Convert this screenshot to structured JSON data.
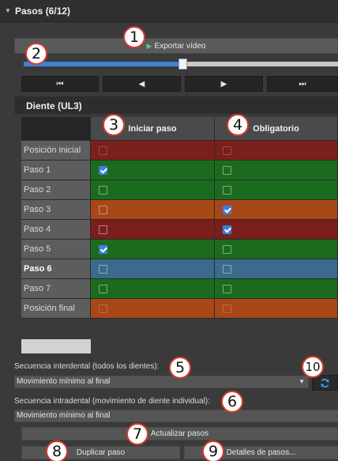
{
  "section": {
    "title": "Pasos (6/12)",
    "icon": "collapse-triangle-icon"
  },
  "export_button": {
    "label": "Exportar vídeo",
    "icon": "play-icon"
  },
  "timeline": {
    "progress": 0.5
  },
  "nav_buttons": [
    {
      "name": "first-step-button",
      "symbol": "⏮"
    },
    {
      "name": "prev-step-button",
      "symbol": "◀"
    },
    {
      "name": "next-step-button",
      "symbol": "▶"
    },
    {
      "name": "last-step-button",
      "symbol": "⏭"
    }
  ],
  "tooth": {
    "title": "Diente (UL3)"
  },
  "grid": {
    "col1": "Iniciar paso",
    "col2": "Obligatorio",
    "rows": [
      {
        "label": "Posición inicial",
        "color": "#7a1f1c",
        "start": false,
        "mandatory": false,
        "dim": true,
        "bold": false
      },
      {
        "label": "Paso 1",
        "color": "#1b6b1e",
        "start": true,
        "mandatory": false,
        "dim": false,
        "bold": false
      },
      {
        "label": "Paso 2",
        "color": "#1b6b1e",
        "start": false,
        "mandatory": false,
        "dim": false,
        "bold": false
      },
      {
        "label": "Paso 3",
        "color": "#a84717",
        "start": false,
        "mandatory": true,
        "dim": false,
        "bold": false
      },
      {
        "label": "Paso 4",
        "color": "#7a1f1c",
        "start": false,
        "mandatory": true,
        "dim": false,
        "bold": false
      },
      {
        "label": "Paso 5",
        "color": "#1b6b1e",
        "start": true,
        "mandatory": false,
        "dim": false,
        "bold": false
      },
      {
        "label": "Paso 6",
        "color": "#3b6a8c",
        "start": false,
        "mandatory": false,
        "dim": false,
        "bold": true
      },
      {
        "label": "Paso 7",
        "color": "#1b6b1e",
        "start": false,
        "mandatory": false,
        "dim": false,
        "bold": false
      },
      {
        "label": "Posición final",
        "color": "#a84717",
        "start": false,
        "mandatory": false,
        "dim": true,
        "bold": false
      }
    ]
  },
  "interdental": {
    "label": "Secuencia interdental (todos los dientes):",
    "value": "Movimiento mínimo al final",
    "refresh_icon": "refresh-icon"
  },
  "intradental": {
    "label": "Secuencia intradental (movimiento de diente individual):",
    "value": "Movimiento mínimo al final"
  },
  "buttons": {
    "update": "Actualizar pasos",
    "duplicate": "Duplicar paso",
    "details": "Detalles de pasos..."
  },
  "markers": [
    "1",
    "2",
    "3",
    "4",
    "5",
    "6",
    "7",
    "8",
    "9",
    "10"
  ]
}
